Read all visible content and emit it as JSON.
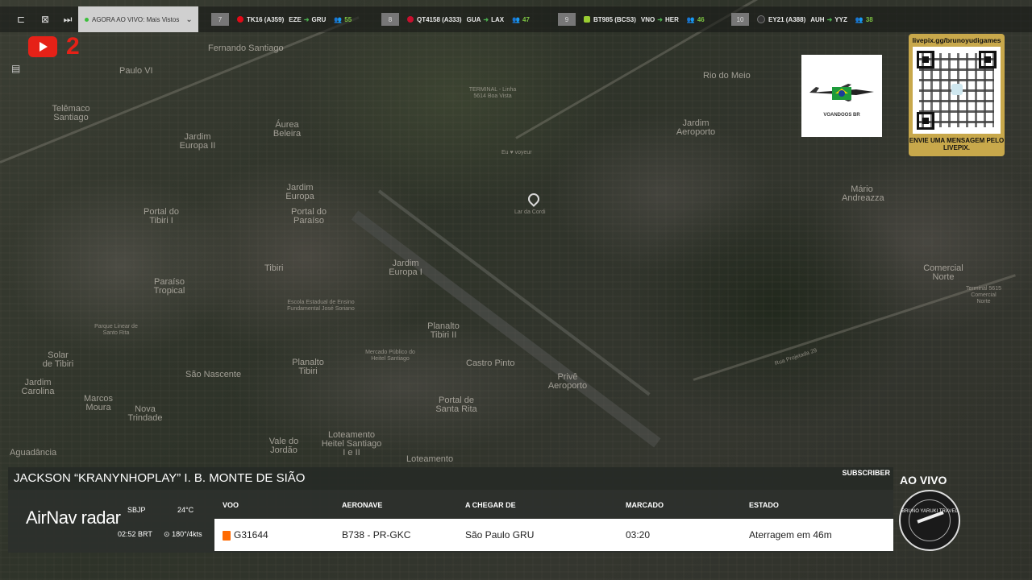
{
  "topbar": {
    "live_label": "AGORA AO VIVO: Mais Vistos",
    "flights": [
      {
        "num": "7",
        "flight": "TK16 (A359)",
        "from": "EZE",
        "to": "GRU",
        "viewers": "55",
        "color": "#e30a17"
      },
      {
        "num": "8",
        "flight": "QT4158 (A333)",
        "from": "GUA",
        "to": "LAX",
        "viewers": "47",
        "color": "#c8102e"
      },
      {
        "num": "9",
        "flight": "BT985 (BCS3)",
        "from": "VNO",
        "to": "HER",
        "viewers": "46",
        "color": "#9acd32"
      },
      {
        "num": "10",
        "flight": "EY21 (A388)",
        "from": "AUH",
        "to": "YYZ",
        "viewers": "38",
        "color": "#333333"
      }
    ]
  },
  "overlay": {
    "yt_number": "2",
    "logo_text": "VOANDOOS BR",
    "qr_url": "livepix.gg/brunoyudigames",
    "qr_message": "ENVIE UMA MENSAGEM PELO LIVEPIX."
  },
  "map_labels": {
    "fernando": "Fernando Santiago",
    "paulo": "Paulo VI",
    "telemaco": "Telêmaco Santiago",
    "aurea": "Áurea Beleira",
    "jardim_europa_ii": "Jardim Europa II",
    "jardim_europa": "Jardim Europa",
    "portal_tibiri_i": "Portal do Tibiri I",
    "portal_paraiso": "Portal do Paraíso",
    "tibiri": "Tibiri",
    "paraiso_tropical": "Paraíso Tropical",
    "jardim_europa_i": "Jardim Europa I",
    "planalto_tibiri_ii": "Planalto Tibiri II",
    "solar_tibiri": "Solar de Tibiri",
    "jardim_carolina": "Jardim Carolina",
    "marcos_moura": "Marcos Moura",
    "nova_trindade": "Nova Trindade",
    "sao_nascente": "São Nascente",
    "planalto_tibiri": "Planalto Tibiri",
    "castro_pinto": "Castro Pinto",
    "portal_santa_rita": "Portal de Santa Rita",
    "prive": "Privê Aeroporto",
    "vale_jordao": "Vale do Jordão",
    "loteamento": "Loteamento Heitel Santiago I e II",
    "aguadancia": "Aguadância",
    "loteamento2": "Loteamento",
    "rio_do_meio": "Rio do Meio",
    "jardim_aeroporto": "Jardim Aeroporto",
    "mario_andreazza": "Mário Andreazza",
    "comercial_norte": "Comercial Norte",
    "terminal": "TERMINAL - Linha 5614 Boa Vista",
    "eu_voyeur": "Eu ♥ voyeur",
    "lar": "Lar da Cordi",
    "terminal2": "Terminal 5615 Comercial Norte",
    "rua": "Rua Projetada 29",
    "parque": "Parque Linear de Santo Rita",
    "escola": "Escola Estadual de Ensino Fundamental José Soriano",
    "mercado": "Mercado Público do Heitel Santiago"
  },
  "lower_third": {
    "name": "JACKSON “KRANYNHOPLAY” I. B. MONTE DE SIÃO",
    "subscriber": "SUBSCRIBER",
    "brand": "AirNav",
    "brand_suffix": "radar",
    "airport": "SBJP",
    "temp": "24°C",
    "time": "02:52 BRT",
    "wind": "180°/4kts",
    "headers": {
      "voo": "VOO",
      "aeronave": "AERONAVE",
      "chegar": "A CHEGAR DE",
      "marcado": "MARCADO",
      "estado": "ESTADO"
    },
    "row": {
      "voo": "G31644",
      "aeronave": "B738 - PR-GKC",
      "chegar": "São Paulo GRU",
      "marcado": "03:20",
      "estado": "Aterragem em 46m"
    }
  },
  "aovivo": "AO VIVO",
  "badge_text": "BRUNO YARUKI TRAVEL"
}
